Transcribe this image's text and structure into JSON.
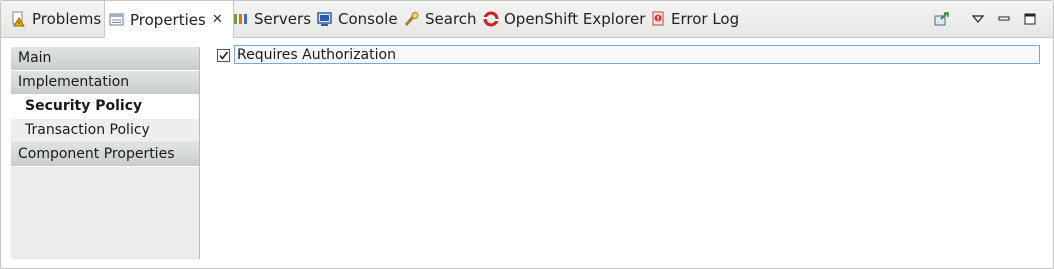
{
  "tabs": [
    {
      "label": "Problems",
      "icon": "problems-icon"
    },
    {
      "label": "Properties",
      "icon": "properties-icon",
      "active": true
    },
    {
      "label": "Servers",
      "icon": "servers-icon"
    },
    {
      "label": "Console",
      "icon": "console-icon"
    },
    {
      "label": "Search",
      "icon": "search-icon"
    },
    {
      "label": "OpenShift Explorer",
      "icon": "openshift-icon"
    },
    {
      "label": "Error Log",
      "icon": "error-log-icon"
    }
  ],
  "toolbar": {
    "pin_icon": "pin-icon",
    "menu_icon": "view-menu-icon",
    "minimize_icon": "minimize-icon",
    "maximize_icon": "maximize-icon"
  },
  "left_tabs": [
    {
      "label": "Main"
    },
    {
      "label": "Implementation"
    },
    {
      "label": "Security Policy",
      "selected": true
    },
    {
      "label": "Transaction Policy"
    },
    {
      "label": "Component Properties"
    }
  ],
  "content": {
    "requires_authorization": {
      "label": "Requires Authorization",
      "checked": true
    }
  },
  "colors": {
    "accent_red": "#cc1f1f",
    "console_blue": "#2a5ca8",
    "focus_border": "#7ea6d4"
  }
}
